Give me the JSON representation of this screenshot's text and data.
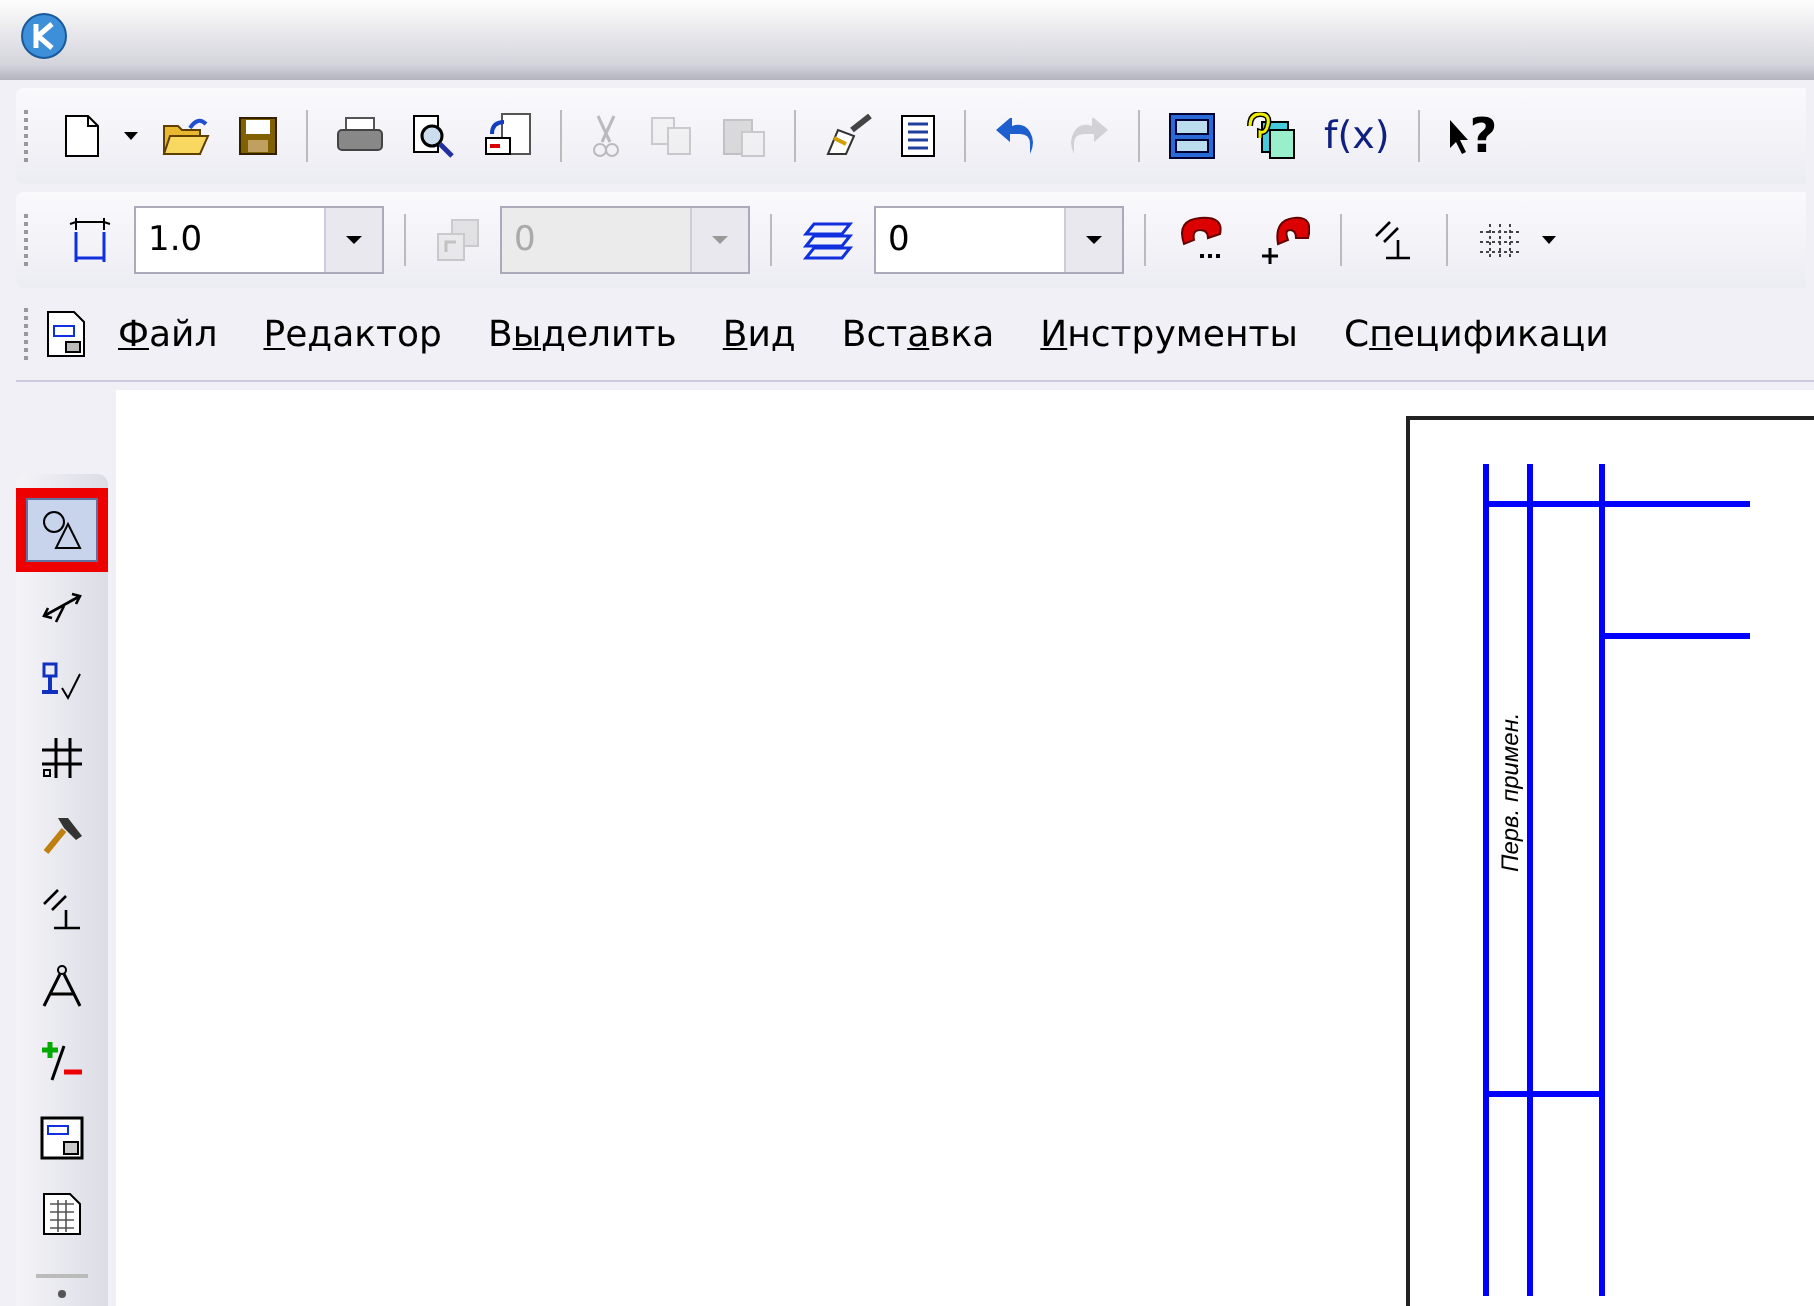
{
  "toolbar_main": [
    {
      "kind": "new",
      "disabled": false
    },
    {
      "kind": "dropdown",
      "disabled": false
    },
    {
      "kind": "open",
      "disabled": false
    },
    {
      "kind": "save",
      "disabled": false
    },
    {
      "kind": "sep"
    },
    {
      "kind": "print",
      "disabled": false
    },
    {
      "kind": "preview",
      "disabled": false
    },
    {
      "kind": "sheet",
      "disabled": false
    },
    {
      "kind": "sep"
    },
    {
      "kind": "cut",
      "disabled": true
    },
    {
      "kind": "copy",
      "disabled": true
    },
    {
      "kind": "paste",
      "disabled": true
    },
    {
      "kind": "sep"
    },
    {
      "kind": "brush",
      "disabled": false
    },
    {
      "kind": "props",
      "disabled": false
    },
    {
      "kind": "sep"
    },
    {
      "kind": "undo",
      "disabled": false
    },
    {
      "kind": "redo",
      "disabled": true
    },
    {
      "kind": "sep"
    },
    {
      "kind": "manager",
      "disabled": false
    },
    {
      "kind": "library",
      "disabled": false
    },
    {
      "kind": "fx",
      "label": "f(x)",
      "disabled": false
    },
    {
      "kind": "sep"
    },
    {
      "kind": "help",
      "label": "?",
      "disabled": false
    }
  ],
  "toolbar_current": [
    {
      "kind": "scale",
      "disabled": false
    },
    {
      "kind": "combo",
      "value": "1.0",
      "disabled": false
    },
    {
      "kind": "sep"
    },
    {
      "kind": "state",
      "disabled": true
    },
    {
      "kind": "combo",
      "value": "0",
      "disabled": true
    },
    {
      "kind": "sep"
    },
    {
      "kind": "layers",
      "disabled": false
    },
    {
      "kind": "combo",
      "value": "0",
      "disabled": false
    },
    {
      "kind": "sep"
    },
    {
      "kind": "magnet",
      "disabled": false
    },
    {
      "kind": "magnet2",
      "disabled": false
    },
    {
      "kind": "sep"
    },
    {
      "kind": "ortho",
      "disabled": false
    },
    {
      "kind": "sep"
    },
    {
      "kind": "grid",
      "disabled": false
    }
  ],
  "menu": [
    {
      "key": "Ф",
      "after": "айл"
    },
    {
      "key": "Р",
      "after": "едактор"
    },
    {
      "before": "В",
      "key": "ы",
      "after": "делить"
    },
    {
      "key": "В",
      "after": "ид"
    },
    {
      "before": "Вст",
      "key": "а",
      "after": "вка"
    },
    {
      "key": "И",
      "after": "нструменты"
    },
    {
      "before": "С",
      "key": "п",
      "after": "ецификаци"
    }
  ],
  "compact_panel": [
    {
      "kind": "geometry",
      "selected": true
    },
    {
      "kind": "dimensions",
      "selected": false
    },
    {
      "kind": "symbols",
      "selected": false
    },
    {
      "kind": "edit",
      "selected": false
    },
    {
      "kind": "param",
      "selected": false
    },
    {
      "kind": "measure",
      "selected": false
    },
    {
      "kind": "select",
      "selected": false
    },
    {
      "kind": "specs",
      "selected": false
    },
    {
      "kind": "report",
      "selected": false
    },
    {
      "kind": "insert",
      "selected": false
    }
  ],
  "sheet": {
    "stamp_label": "Перв. примен."
  }
}
